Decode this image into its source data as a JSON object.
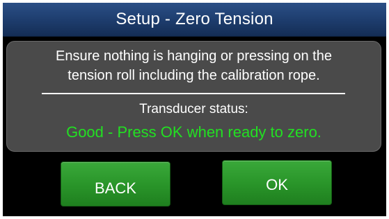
{
  "header": {
    "title": "Setup - Zero Tension"
  },
  "message": {
    "line1": "Ensure nothing is hanging or pressing on the",
    "line2": "tension roll including the calibration rope.",
    "status_label": "Transducer status:",
    "status_value": "Good - Press OK when ready to zero.",
    "status_color": "#22e022"
  },
  "buttons": {
    "back_label": "BACK",
    "ok_label": "OK",
    "color": "#2a962a"
  }
}
